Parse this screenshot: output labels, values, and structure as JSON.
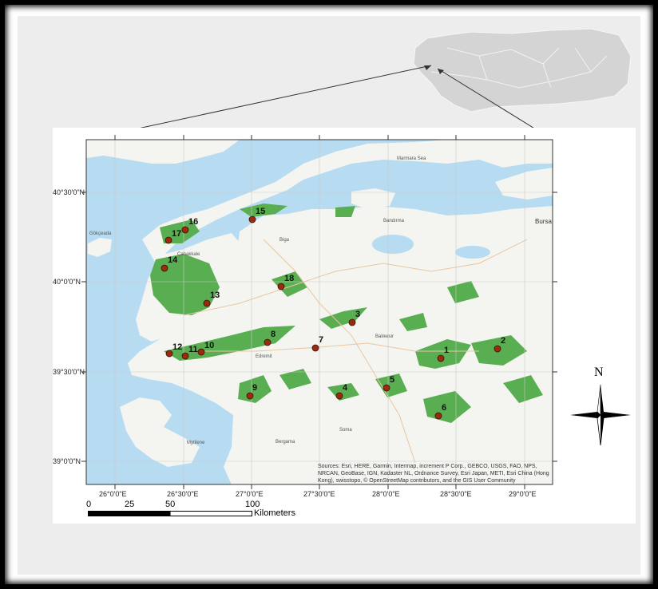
{
  "map": {
    "lat_labels": [
      {
        "text": "40°30'0\"N"
      },
      {
        "text": "40°0'0\"N"
      },
      {
        "text": "39°30'0\"N"
      },
      {
        "text": "39°0'0\"N"
      }
    ],
    "lon_labels": [
      {
        "text": "26°0'0\"E"
      },
      {
        "text": "26°30'0\"E"
      },
      {
        "text": "27°0'0\"E"
      },
      {
        "text": "27°30'0\"E"
      },
      {
        "text": "28°0'0\"E"
      },
      {
        "text": "28°30'0\"E"
      },
      {
        "text": "29°0'0\"E"
      }
    ],
    "sites": [
      {
        "id": "1"
      },
      {
        "id": "2"
      },
      {
        "id": "3"
      },
      {
        "id": "4"
      },
      {
        "id": "5"
      },
      {
        "id": "6"
      },
      {
        "id": "7"
      },
      {
        "id": "8"
      },
      {
        "id": "9"
      },
      {
        "id": "10"
      },
      {
        "id": "11"
      },
      {
        "id": "12"
      },
      {
        "id": "13"
      },
      {
        "id": "14"
      },
      {
        "id": "15"
      },
      {
        "id": "16"
      },
      {
        "id": "17"
      },
      {
        "id": "18"
      }
    ],
    "place_names": [
      "Marmara Sea",
      "Bandırma",
      "Bursa",
      "Biga",
      "Balıkesir",
      "Edremit",
      "Bergama",
      "Mytilene",
      "Çanakkale",
      "Gökçeada",
      "Soma"
    ],
    "attribution": "Sources: Esri, HERE, Garmin, Intermap, increment P Corp., GEBCO, USGS, FAO, NPS, NRCAN, GeoBase, IGN, Kadaster NL, Ordnance Survey, Esri Japan, METI, Esri China (Hong Kong), swisstopo, © OpenStreetMap contributors, and the GIS User Community",
    "colors": {
      "sea": "#b7dcf2",
      "land": "#f4f4f0",
      "forest": "#5aae52",
      "site": "#9a2a10"
    }
  },
  "scale_bar": {
    "ticks": [
      "0",
      "25",
      "50",
      "100"
    ],
    "unit": "Kilometers"
  },
  "north_arrow": {
    "label": "N"
  }
}
